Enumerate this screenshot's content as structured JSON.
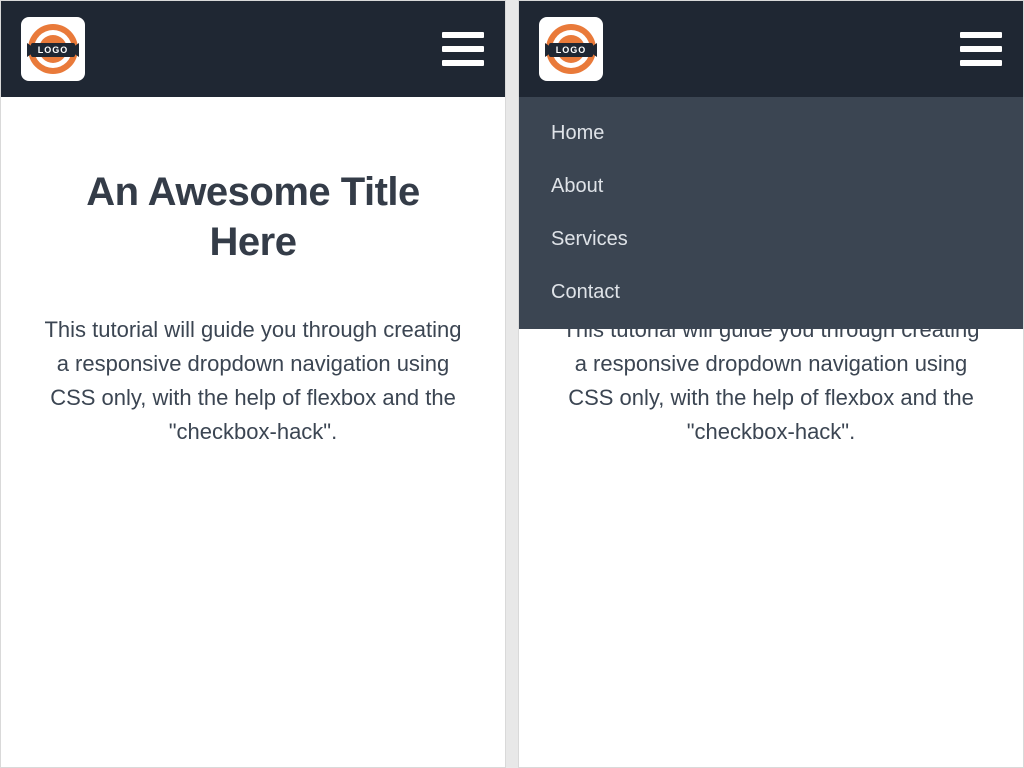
{
  "logo_text": "LOGO",
  "nav": {
    "items": [
      {
        "label": "Home"
      },
      {
        "label": "About"
      },
      {
        "label": "Services"
      },
      {
        "label": "Contact"
      }
    ]
  },
  "page": {
    "title": "An Awesome Title Here",
    "lead": "This tutorial will guide you through creating a responsive dropdown navigation using CSS only, with the help of flexbox and the \"checkbox-hack\"."
  }
}
